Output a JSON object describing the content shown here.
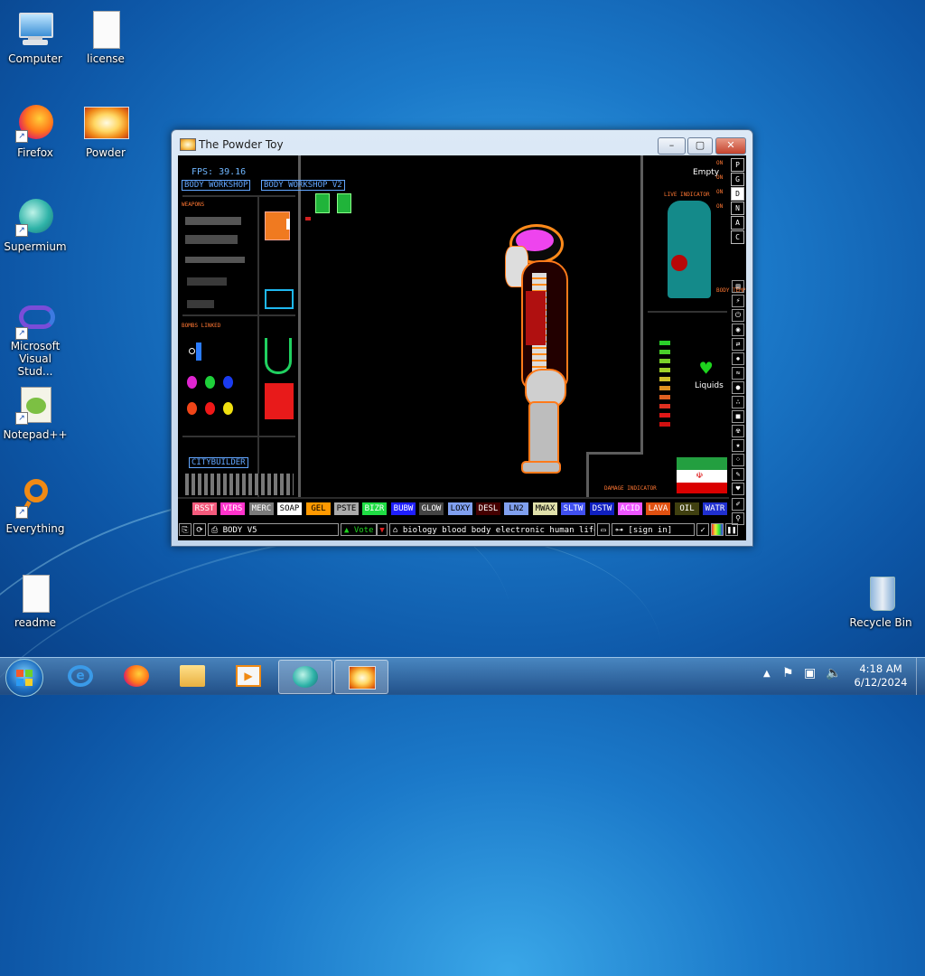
{
  "desktop": {
    "icons": [
      {
        "label": "Computer"
      },
      {
        "label": "license"
      },
      {
        "label": "Firefox"
      },
      {
        "label": "Powder"
      },
      {
        "label": "Supermium"
      },
      {
        "label": "Microsoft Visual Stud..."
      },
      {
        "label": "Notepad++"
      },
      {
        "label": "Everything"
      },
      {
        "label": "readme"
      },
      {
        "label": "Recycle Bin"
      }
    ]
  },
  "window": {
    "title": "The Powder Toy",
    "minimize": "–",
    "maximize": "▢",
    "close": "✕"
  },
  "game": {
    "fps": "FPS: 39.16",
    "save_tabs": [
      "BODY WORKSHOP",
      "BODY WORKSHOP V2"
    ],
    "weapons_label": "WEAPONS",
    "bombs_label": "BOMBS LINKED",
    "citybuilder": "CITYBUILDER",
    "empty": "Empty",
    "on_labels": [
      "ON",
      "ON",
      "ON",
      "ON"
    ],
    "live_indicator": "LIVE INDICATOR",
    "body_temp": "BODY TEMP",
    "liquids": "Liquids",
    "damage_indicator": "DAMAGE INDICATOR",
    "side_buttons": [
      "P",
      "G",
      "D",
      "N",
      "A",
      "C"
    ],
    "elements": [
      {
        "name": "RSST",
        "color": "#f45a7c"
      },
      {
        "name": "VIRS",
        "color": "#ff33cc"
      },
      {
        "name": "MERC",
        "color": "#7b7b7b"
      },
      {
        "name": "SOAP",
        "color": "#ffffff"
      },
      {
        "name": "GEL",
        "color": "#ff9900"
      },
      {
        "name": "PSTE",
        "color": "#aaaaaa"
      },
      {
        "name": "BIZR",
        "color": "#1fdd44"
      },
      {
        "name": "BUBW",
        "color": "#1f1fff"
      },
      {
        "name": "GLOW",
        "color": "#444444"
      },
      {
        "name": "LOXY",
        "color": "#80a0ef"
      },
      {
        "name": "DESL",
        "color": "#440000"
      },
      {
        "name": "LN2",
        "color": "#80a0ef"
      },
      {
        "name": "MWAX",
        "color": "#e0e0aa"
      },
      {
        "name": "SLTW",
        "color": "#4050f0"
      },
      {
        "name": "DSTW",
        "color": "#1020c0"
      },
      {
        "name": "ACID",
        "color": "#ed55ff"
      },
      {
        "name": "LAVA",
        "color": "#e05010"
      },
      {
        "name": "OIL",
        "color": "#404010"
      },
      {
        "name": "WATR",
        "color": "#2030d0"
      }
    ],
    "save_name": "BODY V5",
    "vote": "Vote",
    "tags": "biology blood body electronic human life...",
    "sign_in": "[sign in]"
  },
  "taskbar": {
    "time": "4:18 AM",
    "date": "6/12/2024"
  }
}
